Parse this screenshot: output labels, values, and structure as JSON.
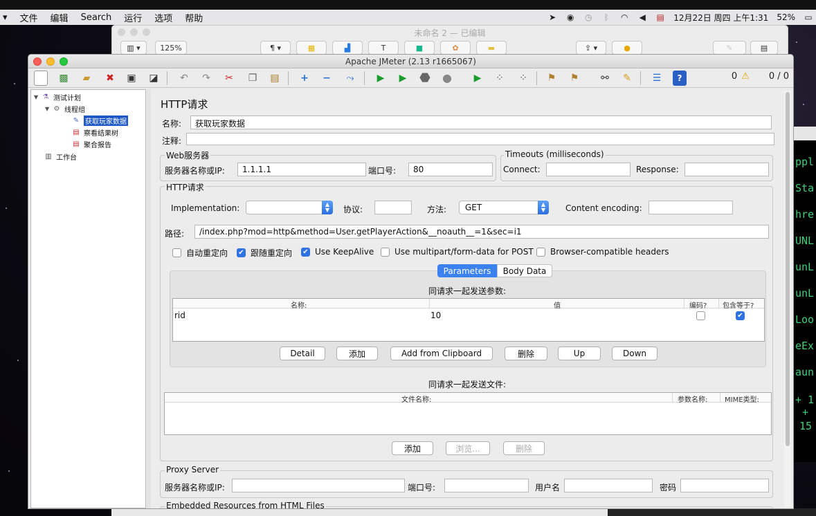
{
  "menubar": {
    "items": [
      "文件",
      "编辑",
      "Search",
      "运行",
      "选项",
      "帮助"
    ],
    "status": {
      "battery": "52%",
      "datetime": "12月22日 周四 上午1:31"
    }
  },
  "bg_window": {
    "title": "未命名 2 — 已编辑",
    "zoom": "125%"
  },
  "terminal_fragments": [
    "ppl",
    "Sta",
    "hre",
    "UNL",
    "unL",
    "unL",
    "Loo",
    "eEx",
    "aun",
    "+ 1",
    "+",
    "15"
  ],
  "window": {
    "title": "Apache JMeter (2.13 r1665067)",
    "status_warnings": "0",
    "status_threads": "0 / 0"
  },
  "tree": {
    "nodes": [
      "测试计划",
      "线程组",
      "获取玩家数据",
      "察看结果树",
      "聚合报告",
      "工作台"
    ]
  },
  "panel": {
    "heading": "HTTP请求",
    "name_label": "名称:",
    "name_value": "获取玩家数据",
    "comment_label": "注释:",
    "comment_value": "",
    "web_server": {
      "legend": "Web服务器",
      "server_label": "服务器名称或IP:",
      "server_value": "1.1.1.1",
      "port_label": "端口号:",
      "port_value": "80"
    },
    "timeouts": {
      "legend": "Timeouts (milliseconds)",
      "connect_label": "Connect:",
      "connect_value": "",
      "response_label": "Response:",
      "response_value": ""
    },
    "http_request": {
      "legend": "HTTP请求",
      "impl_label": "Implementation:",
      "impl_value": "",
      "protocol_label": "协议:",
      "protocol_value": "",
      "method_label": "方法:",
      "method_value": "GET",
      "encoding_label": "Content encoding:",
      "encoding_value": "",
      "path_label": "路径:",
      "path_value": "/index.php?mod=http&method=User.getPlayerAction&__noauth__=1&sec=i1",
      "checkboxes": [
        {
          "label": "自动重定向",
          "checked": false
        },
        {
          "label": "跟随重定向",
          "checked": true
        },
        {
          "label": "Use KeepAlive",
          "checked": true
        },
        {
          "label": "Use multipart/form-data for POST",
          "checked": false
        },
        {
          "label": "Browser-compatible headers",
          "checked": false
        }
      ],
      "tabs": [
        "Parameters",
        "Body Data"
      ],
      "active_tab": "Parameters"
    },
    "params": {
      "caption": "同请求一起发送参数:",
      "columns": [
        "名称:",
        "值",
        "编码?",
        "包含等于?"
      ],
      "rows": [
        {
          "name": "rid",
          "value": "10",
          "encode": false,
          "include_equals": true
        }
      ],
      "buttons": [
        "Detail",
        "添加",
        "Add from Clipboard",
        "删除",
        "Up",
        "Down"
      ]
    },
    "files": {
      "caption": "同请求一起发送文件:",
      "columns": [
        "文件名称:",
        "参数名称:",
        "MIME类型:"
      ],
      "buttons": [
        "添加",
        "浏览...",
        "删除"
      ]
    },
    "proxy": {
      "legend": "Proxy Server",
      "server_label": "服务器名称或IP:",
      "server_value": "",
      "port_label": "端口号:",
      "port_value": "",
      "user_label": "用户名",
      "user_value": "",
      "pass_label": "密码",
      "pass_value": ""
    },
    "embedded_legend": "Embedded Resources from HTML Files"
  },
  "colors": {
    "selection": "#1c58c8",
    "accent": "#2f73e3",
    "run_green": "#1a9c2c"
  },
  "icons": {
    "toolbar_run": "play-icon",
    "toolbar_clear": "broom-icon",
    "toolbar_search": "binoculars-icon",
    "toolbar_help": "help-icon"
  }
}
